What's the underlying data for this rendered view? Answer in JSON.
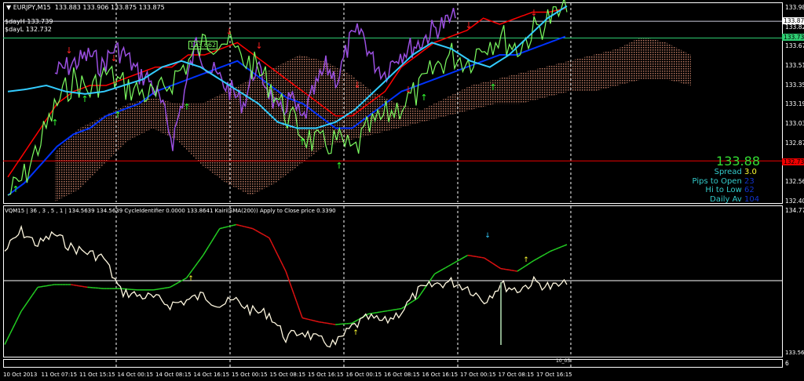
{
  "header": {
    "symbol": "EURJPY,M15",
    "ohlc": "133.883 133.906 133.875 133.875",
    "day_high": "$dayH 133.739",
    "day_low": "$dayL 132.732",
    "cloud_label": "133.662"
  },
  "price_axis": {
    "labels": [
      "133.985",
      "133.825",
      "133.670",
      "133.510",
      "133.350",
      "133.195",
      "133.035",
      "132.875",
      "132.560",
      "132.400"
    ],
    "bid_tag": "133.875",
    "green_tag": "133.738",
    "red_tag": "132.732"
  },
  "info_panel": {
    "price": "133.88",
    "spread_label": "Spread",
    "spread": "3.0",
    "pips_label": "Pips to Open",
    "pips": "23",
    "hilo_label": "Hi to Low",
    "hilo": "62",
    "daily_label": "Daily Av",
    "daily": "104"
  },
  "indicator": {
    "header": "VQM15 | 36 , 3 , 5 , 1 |  134.5639 134.5639  CycleIdentifier 0.0000 133.8641  Kairi(SMA(200)) Apply to Close price 0.3390",
    "axis_top": "134.775",
    "axis_bottom": "133.5687",
    "mini_label": "10_05"
  },
  "mini_pane": {
    "axis": "6"
  },
  "time_axis": [
    "10 Oct 2013",
    "11 Oct 07:15",
    "11 Oct 15:15",
    "14 Oct 00:15",
    "14 Oct 08:15",
    "14 Oct 16:15",
    "15 Oct 00:15",
    "15 Oct 08:15",
    "15 Oct 16:15",
    "16 Oct 00:15",
    "16 Oct 08:15",
    "16 Oct 16:15",
    "17 Oct 00:15",
    "17 Oct 08:15",
    "17 Oct 16:15"
  ],
  "colors": {
    "price": "#7CFC60",
    "cloud": "#E9967A",
    "red": "#FF0000",
    "blue": "#0033FF",
    "purple": "#9A4FE0",
    "cyan": "#33CCFF",
    "yellow": "#FFFF33",
    "white": "#FFFFFF"
  },
  "series": {
    "price": [
      132.45,
      132.6,
      132.9,
      133.2,
      133.4,
      133.3,
      133.45,
      133.35,
      133.3,
      133.25,
      133.4,
      133.55,
      133.7,
      133.75,
      133.6,
      133.5,
      133.35,
      133.1,
      132.95,
      132.85,
      132.9,
      132.8,
      133.0,
      133.1,
      133.2,
      133.3,
      133.5,
      133.6,
      133.55,
      133.7,
      133.75,
      133.65,
      133.8,
      133.9,
      133.95
    ],
    "purple": [
      133.45,
      133.5,
      133.55,
      133.6,
      133.5,
      133.65,
      133.6,
      133.45,
      133.4,
      133.2,
      132.9,
      133.3,
      133.7,
      133.5,
      133.4,
      133.3,
      133.2,
      133.5,
      133.35,
      133.1,
      133.25,
      133.05,
      133.3,
      133.5,
      133.4,
      133.7,
      133.8,
      133.55,
      133.45,
      133.6,
      133.65,
      133.7,
      133.8,
      133.85,
      133.9
    ],
    "red": [
      132.6,
      132.8,
      133.0,
      133.2,
      133.3,
      133.35,
      133.35,
      133.4,
      133.45,
      133.5,
      133.5,
      133.6,
      133.6,
      133.65,
      133.7,
      133.6,
      133.5,
      133.4,
      133.3,
      133.2,
      133.1,
      133.1,
      133.2,
      133.3,
      133.5,
      133.6,
      133.7,
      133.75,
      133.8,
      133.9,
      133.85,
      133.9,
      133.95,
      133.95,
      133.98
    ],
    "blue": [
      132.45,
      132.55,
      132.7,
      132.85,
      132.95,
      133.0,
      133.1,
      133.15,
      133.2,
      133.3,
      133.35,
      133.4,
      133.45,
      133.5,
      133.55,
      133.45,
      133.35,
      133.25,
      133.2,
      133.1,
      133.0,
      133.0,
      133.1,
      133.2,
      133.3,
      133.35,
      133.4,
      133.45,
      133.5,
      133.55,
      133.6,
      133.6,
      133.65,
      133.7,
      133.75
    ],
    "cyan": [
      133.3,
      133.32,
      133.35,
      133.3,
      133.28,
      133.3,
      133.35,
      133.4,
      133.5,
      133.55,
      133.5,
      133.4,
      133.3,
      133.2,
      133.05,
      133.0,
      133.0,
      133.05,
      133.15,
      133.3,
      133.45,
      133.6,
      133.7,
      133.65,
      133.55,
      133.5,
      133.6,
      133.75,
      133.9,
      134.0
    ],
    "cloud_top": [
      132.8,
      133.0,
      133.1,
      133.2,
      133.25,
      133.2,
      133.2,
      133.3,
      133.4,
      133.5,
      133.6,
      133.55,
      133.45,
      133.3,
      133.2,
      133.15,
      133.25,
      133.35,
      133.4,
      133.45,
      133.5,
      133.55,
      133.6,
      133.65,
      133.75,
      133.7,
      133.6
    ],
    "cloud_bottom": [
      132.4,
      132.5,
      132.7,
      132.9,
      133.0,
      132.9,
      132.7,
      132.55,
      132.45,
      132.55,
      132.7,
      132.85,
      132.9,
      132.95,
      133.0,
      133.05,
      133.1,
      133.15,
      133.2,
      133.2,
      133.25,
      133.3,
      133.3,
      133.35,
      133.4,
      133.4,
      133.35
    ],
    "osc_white": [
      75,
      90,
      80,
      88,
      78,
      74,
      70,
      45,
      42,
      40,
      35,
      38,
      42,
      35,
      38,
      30,
      28,
      10,
      15,
      8,
      5,
      18,
      25,
      22,
      30,
      45,
      50,
      52,
      48,
      38,
      50,
      46,
      52,
      48,
      50
    ],
    "osc_signal": [
      5,
      30,
      48,
      50,
      50,
      48,
      47,
      47,
      46,
      46,
      48,
      55,
      72,
      92,
      95,
      92,
      85,
      60,
      25,
      22,
      20,
      21,
      28,
      30,
      32,
      40,
      58,
      65,
      72,
      70,
      62,
      60,
      68,
      75,
      80
    ]
  }
}
